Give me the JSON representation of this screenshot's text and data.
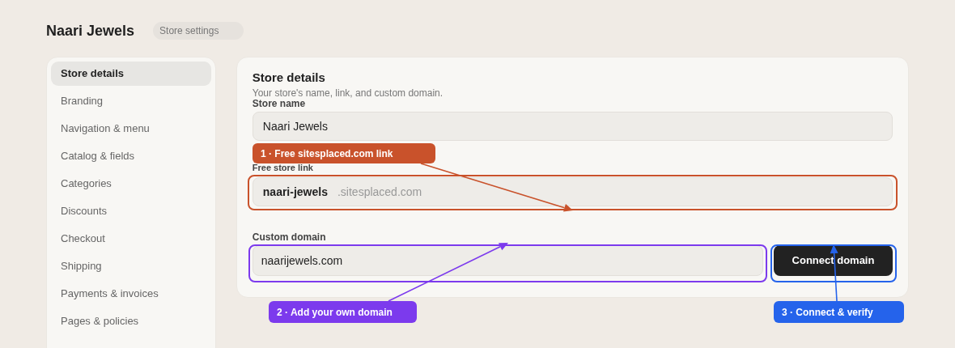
{
  "header": {
    "title": "Naari Jewels",
    "badge": "Store settings"
  },
  "sidebar": {
    "items": [
      {
        "label": "Store details",
        "selected": true
      },
      {
        "label": "Branding",
        "selected": false
      },
      {
        "label": "Navigation & menu",
        "selected": false
      },
      {
        "label": "Catalog & fields",
        "selected": false
      },
      {
        "label": "Categories",
        "selected": false
      },
      {
        "label": "Discounts",
        "selected": false
      },
      {
        "label": "Checkout",
        "selected": false
      },
      {
        "label": "Shipping",
        "selected": false
      },
      {
        "label": "Payments & invoices",
        "selected": false
      },
      {
        "label": "Pages & policies",
        "selected": false
      }
    ]
  },
  "panel": {
    "title": "Store details",
    "subtitle": "Your store's name, link, and custom domain.",
    "store_name": {
      "label": "Store name",
      "value": "Naari Jewels"
    },
    "store_link": {
      "label": "Free store link",
      "slug": "naari-jewels",
      "suffix": ".sitesplaced.com"
    },
    "custom_domain": {
      "label": "Custom domain",
      "value": "naarijewels.com",
      "button": "Connect domain"
    }
  },
  "annotations": [
    {
      "label": "1 · Free sitesplaced.com link",
      "color": "#c9522b"
    },
    {
      "label": "2 · Add your own domain",
      "color": "#7c3aed"
    },
    {
      "label": "3 · Connect & verify",
      "color": "#2563eb"
    }
  ]
}
